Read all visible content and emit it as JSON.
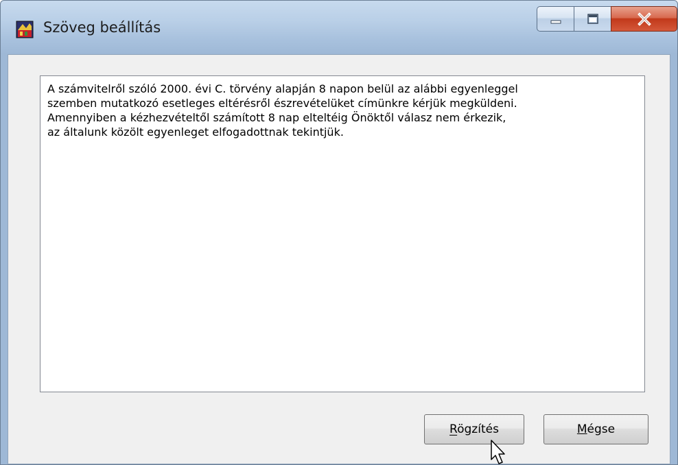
{
  "window": {
    "title": "Szöveg beállítás"
  },
  "text_area": {
    "lines": [
      "A számvitelről szóló 2000. évi C. törvény alapján 8 napon belül az alábbi egyenleggel",
      "szemben mutatkozó esetleges eltérésről  észrevételüket  címünkre  kérjük  megküldeni.",
      "Amennyiben  a  kézhezvételtől  számított  8 nap elteltéig Önöktől válasz nem érkezik,",
      "az  általunk közölt egyenleget elfogadottnak tekintjük."
    ]
  },
  "buttons": {
    "save_label": "Rögzítés",
    "cancel_label": "Mégse"
  },
  "icons": {
    "app": "app-icon",
    "minimize": "minimize-icon",
    "maximize": "maximize-icon",
    "close": "close-icon",
    "cursor": "mouse-cursor-icon"
  },
  "colors": {
    "close_button": "#c2391a",
    "client_background": "#f0f0f0"
  }
}
